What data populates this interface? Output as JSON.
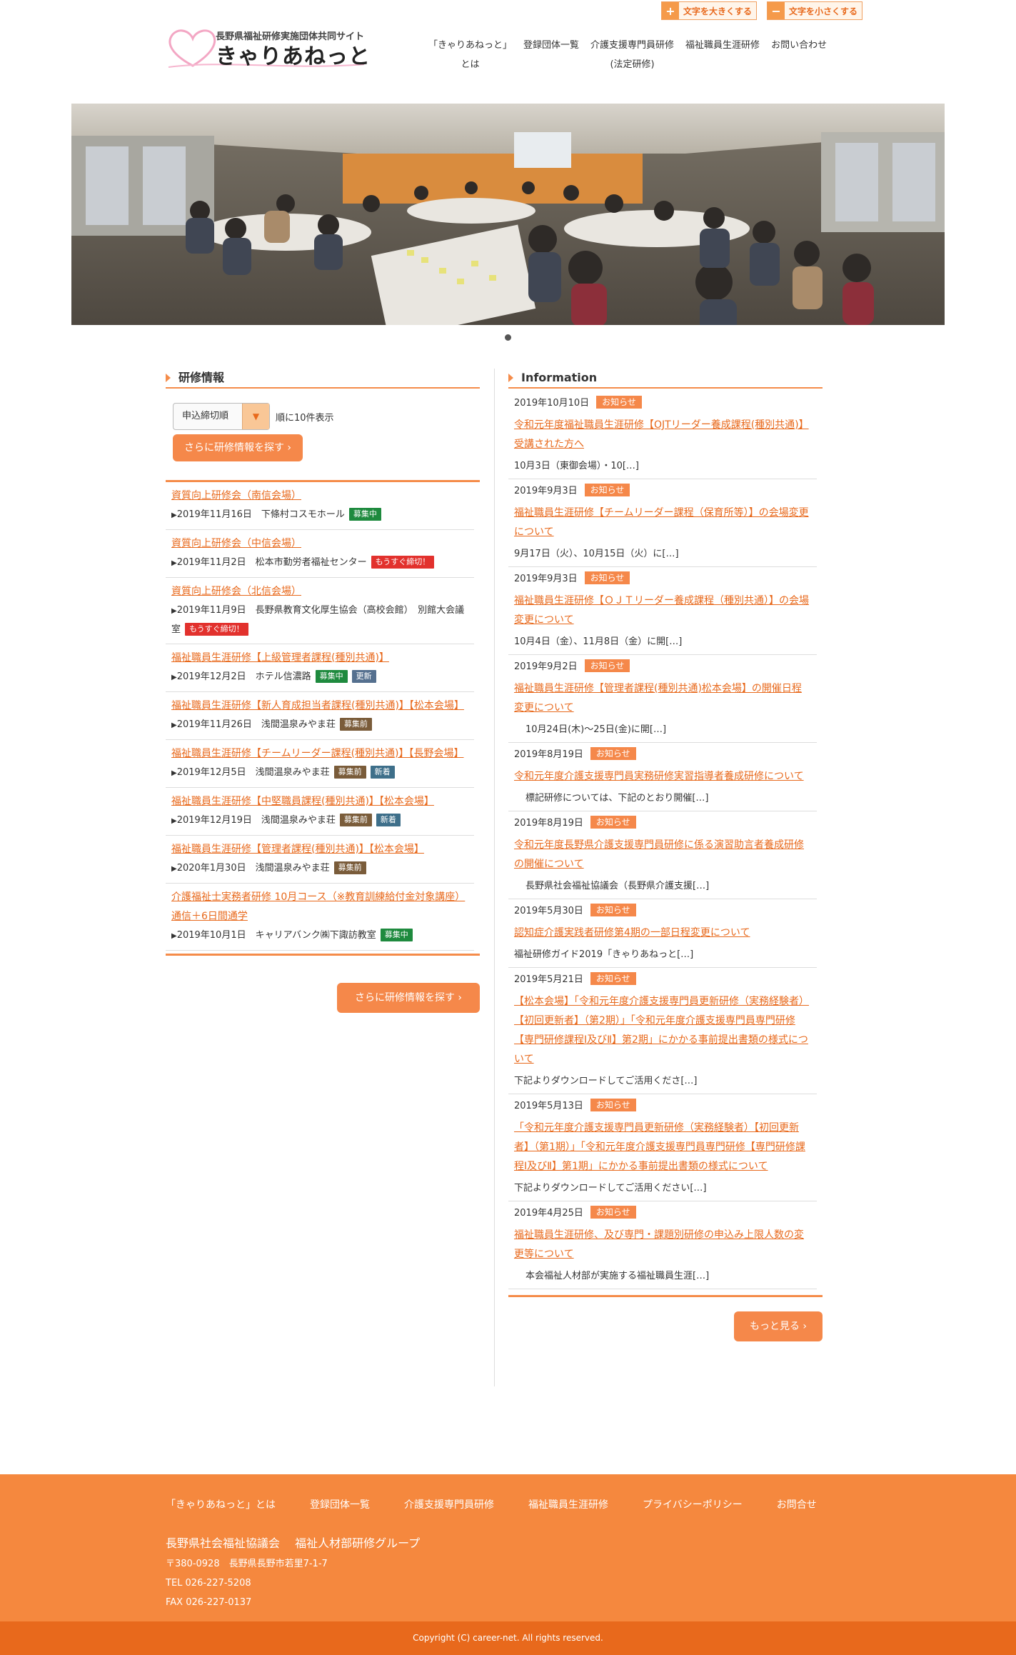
{
  "header": {
    "font_larger": "文字を大きくする",
    "font_smaller": "文字を小さくする",
    "logo_sub": "長野県福祉研修実施団体共同サイト",
    "logo_main": "きゃりあねっと",
    "nav": [
      {
        "line1": "「きゃりあねっと」",
        "line2": "とは"
      },
      {
        "line1": "登録団体一覧",
        "line2": ""
      },
      {
        "line1": "介護支援専門員研修",
        "line2": "(法定研修)"
      },
      {
        "line1": "福祉職員生涯研修",
        "line2": ""
      },
      {
        "line1": "お問い合わせ",
        "line2": ""
      }
    ]
  },
  "training": {
    "title": "研修情報",
    "sort_value": "申込締切順",
    "sort_suffix": "順に10件表示",
    "search_button": "さらに研修情報を探す",
    "items": [
      {
        "title": "資質向上研修会（南信会場）",
        "meta": "2019年11月16日　下條村コスモホール",
        "badges": [
          {
            "text": "募集中",
            "kind": "green"
          }
        ]
      },
      {
        "title": "資質向上研修会（中信会場）",
        "meta": "2019年11月2日　松本市勤労者福祉センター",
        "badges": [
          {
            "text": "もうすぐ締切！",
            "kind": "red"
          }
        ]
      },
      {
        "title": "資質向上研修会（北信会場）",
        "meta": "2019年11月9日　長野県教育文化厚生協会（高校会館）　別館大会議室",
        "badges": [
          {
            "text": "もうすぐ締切！",
            "kind": "red"
          }
        ]
      },
      {
        "title": "福祉職員生涯研修【上級管理者課程(種別共通)】",
        "meta": "2019年12月2日　ホテル信濃路",
        "badges": [
          {
            "text": "募集中",
            "kind": "green"
          },
          {
            "text": "更新",
            "kind": "gray"
          }
        ]
      },
      {
        "title": "福祉職員生涯研修【新人育成担当者課程(種別共通)】【松本会場】",
        "meta": "2019年11月26日　浅間温泉みやま荘",
        "badges": [
          {
            "text": "募集前",
            "kind": "brown"
          }
        ]
      },
      {
        "title": "福祉職員生涯研修【チームリーダー課程(種別共通)】【長野会場】",
        "meta": "2019年12月5日　浅間温泉みやま荘",
        "badges": [
          {
            "text": "募集前",
            "kind": "brown"
          },
          {
            "text": "新着",
            "kind": "blue"
          }
        ]
      },
      {
        "title": "福祉職員生涯研修【中堅職員課程(種別共通)】【松本会場】",
        "meta": "2019年12月19日　浅間温泉みやま荘",
        "badges": [
          {
            "text": "募集前",
            "kind": "brown"
          },
          {
            "text": "新着",
            "kind": "blue"
          }
        ]
      },
      {
        "title": "福祉職員生涯研修【管理者課程(種別共通)】【松本会場】",
        "meta": "2020年1月30日　浅間温泉みやま荘",
        "badges": [
          {
            "text": "募集前",
            "kind": "brown"
          }
        ]
      },
      {
        "title": "介護福祉士実務者研修 10月コース（※教育訓練給付金対象講座）通信＋6日間通学",
        "meta": "2019年10月1日　キャリアバンク㈱下諏訪教室",
        "badges": [
          {
            "text": "募集中",
            "kind": "green"
          }
        ]
      }
    ]
  },
  "information": {
    "title": "Information",
    "more_button": "もっと見る",
    "items": [
      {
        "date": "2019年10月10日",
        "badge": "お知らせ",
        "title": "令和元年度福祉職員生涯研修【OJTリーダー養成課程(種別共通)】受講された方へ",
        "excerpt": "10月3日（東御会場）・10[…]",
        "indent": false
      },
      {
        "date": "2019年9月3日",
        "badge": "お知らせ",
        "title": "福祉職員生涯研修【チームリーダー課程（保育所等）】の会場変更について",
        "excerpt": "9月17日（火）、10月15日（火）に[…]",
        "indent": false
      },
      {
        "date": "2019年9月3日",
        "badge": "お知らせ",
        "title": "福祉職員生涯研修【ＯＪＴリーダー養成課程（種別共通）】の会場変更について",
        "excerpt": "10月4日（金）、11月8日（金）に開[…]",
        "indent": false
      },
      {
        "date": "2019年9月2日",
        "badge": "お知らせ",
        "title": "福祉職員生涯研修【管理者課程(種別共通)松本会場】の開催日程変更について",
        "excerpt": "10月24日(木)～25日(金)に開[…]",
        "indent": true
      },
      {
        "date": "2019年8月19日",
        "badge": "お知らせ",
        "title": "令和元年度介護支援専門員実務研修実習指導者養成研修について",
        "excerpt": "標記研修については、下記のとおり開催[…]",
        "indent": true
      },
      {
        "date": "2019年8月19日",
        "badge": "お知らせ",
        "title": "令和元年度長野県介護支援専門員研修に係る演習助言者養成研修の開催について",
        "excerpt": "長野県社会福祉協議会（長野県介護支援[…]",
        "indent": true
      },
      {
        "date": "2019年5月30日",
        "badge": "お知らせ",
        "title": "認知症介護実践者研修第4期の一部日程変更について",
        "excerpt": "福祉研修ガイド2019「きゃりあねっと[…]",
        "indent": false
      },
      {
        "date": "2019年5月21日",
        "badge": "お知らせ",
        "title": "【松本会場】「令和元年度介護支援専門員更新研修（実務経験者）【初回更新者】（第2期）」「令和元年度介護支援専門員専門研修【専門研修課程Ⅰ及びⅡ】第2期」にかかる事前提出書類の様式について",
        "excerpt": "下記よりダウンロードしてご活用くださ[…]",
        "indent": false
      },
      {
        "date": "2019年5月13日",
        "badge": "お知らせ",
        "title": "「令和元年度介護支援専門員更新研修（実務経験者）【初回更新者】（第1期）」「令和元年度介護支援専門員専門研修【専門研修課程Ⅰ及びⅡ】第1期」にかかる事前提出書類の様式について",
        "excerpt": "下記よりダウンロードしてご活用ください[…]",
        "indent": false
      },
      {
        "date": "2019年4月25日",
        "badge": "お知らせ",
        "title": "福祉職員生涯研修、及び専門・課題別研修の申込み上限人数の変更等について",
        "excerpt": "本会福祉人材部が実施する福祉職員生涯[…]",
        "indent": true
      }
    ]
  },
  "footer": {
    "nav": [
      "「きゃりあねっと」とは",
      "登録団体一覧",
      "介護支援専門員研修",
      "福祉職員生涯研修",
      "プライバシーポリシー",
      "お問合せ"
    ],
    "org": "長野県社会福祉協議会　 福祉人材部研修グループ",
    "postal": "〒380-0928　長野県長野市若里7-1-7",
    "tel": "TEL 026-227-5208",
    "fax": "FAX 026-227-0137",
    "copyright": "Copyright (C) career-net. All rights reserved."
  },
  "colors": {
    "accent": "#f58c4a",
    "link": "#e8691c",
    "footer": "#f5883e"
  }
}
